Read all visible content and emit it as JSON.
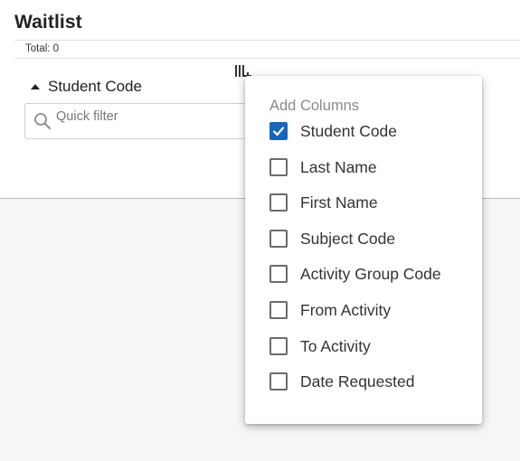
{
  "page": {
    "title": "Waitlist",
    "total_label": "Total: 0"
  },
  "grid": {
    "column_header": "Student Code",
    "sort_direction": "ascending",
    "quick_filter": {
      "placeholder": "Quick filter",
      "value": ""
    }
  },
  "column_menu": {
    "heading": "Add Columns",
    "items": [
      {
        "label": "Student Code",
        "checked": true
      },
      {
        "label": "Last Name",
        "checked": false
      },
      {
        "label": "First Name",
        "checked": false
      },
      {
        "label": "Subject Code",
        "checked": false
      },
      {
        "label": "Activity Group Code",
        "checked": false
      },
      {
        "label": "From Activity",
        "checked": false
      },
      {
        "label": "To Activity",
        "checked": false
      },
      {
        "label": "Date Requested",
        "checked": false
      }
    ]
  },
  "icons": {
    "column_toggle": "columns-icon",
    "search": "search-icon",
    "sort": "sort-ascending-icon"
  },
  "colors": {
    "accent": "#1565c0",
    "panel_background": "#ffffff",
    "page_background": "#f6f6f6"
  }
}
